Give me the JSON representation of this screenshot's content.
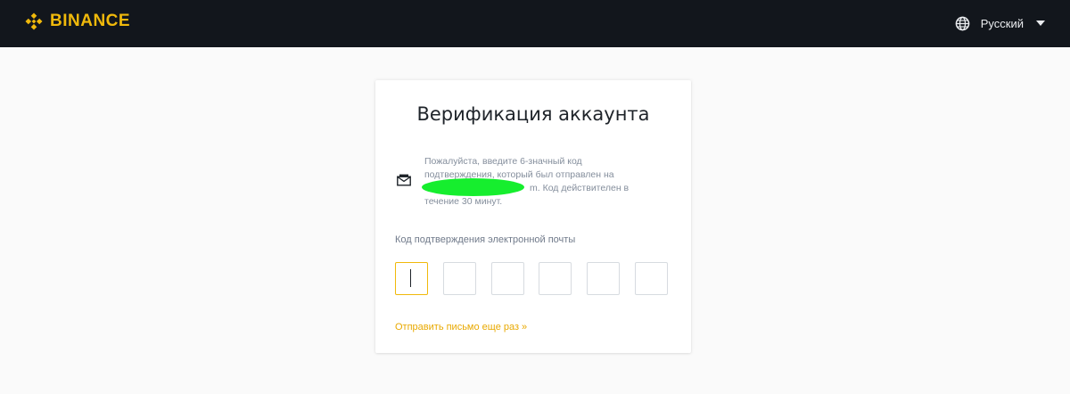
{
  "header": {
    "brand": "BINANCE",
    "language": "Русский",
    "icons": [
      "binance-logo-icon",
      "globe-icon",
      "chevron-down-icon"
    ]
  },
  "colors": {
    "header_bg": "#12161c",
    "brand": "#f0b90b",
    "page_bg": "#fafafa",
    "link": "#e9a900",
    "redaction": "#16ee2e"
  },
  "card": {
    "title": "Верификация аккаунта",
    "info_line1": "Пожалуйста, введите 6-значный код",
    "info_line2": "подтверждения, который был отправлен на",
    "info_line3_tail": "m. Код действителен в",
    "info_line4": "течение 30 минут.",
    "mail_icon": "envelope-icon",
    "field_label": "Код подтверждения электронной почты",
    "otp_values": [
      "",
      "",
      "",
      "",
      "",
      ""
    ],
    "resend_label": "Отправить письмо еще раз",
    "resend_chevron": "»"
  }
}
